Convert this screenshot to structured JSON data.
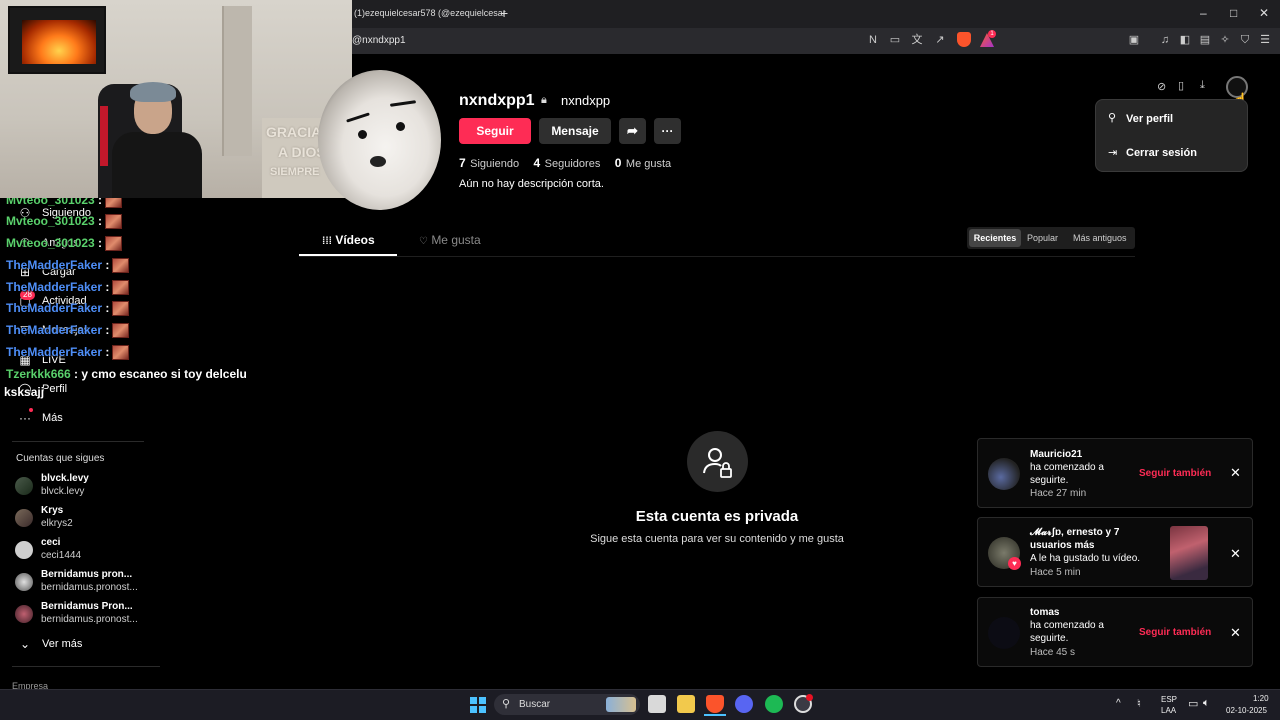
{
  "browser": {
    "tab_title": "(1)ezequielcesar578 (@ezequielcesar",
    "new_tab": "+",
    "url": "@nxndxpp1",
    "window_controls": {
      "minimize": "–",
      "maximize": "□",
      "close": "✕"
    },
    "badge_count": "1"
  },
  "sidebar": {
    "items": [
      {
        "label": "Siguiendo",
        "icon": "following-icon"
      },
      {
        "label": "Amigos",
        "icon": "friends-icon"
      },
      {
        "label": "Cargar",
        "icon": "upload-icon"
      },
      {
        "label": "Actividad",
        "icon": "activity-icon",
        "badge": "28"
      },
      {
        "label": "Mensajes",
        "icon": "messages-icon"
      },
      {
        "label": "LIVE",
        "icon": "live-icon"
      },
      {
        "label": "Perfil",
        "icon": "profile-icon"
      },
      {
        "label": "Más",
        "icon": "more-icon"
      }
    ],
    "following_title": "Cuentas que sigues",
    "accounts": [
      {
        "name": "blvck.levy",
        "handle": "blvck.levy"
      },
      {
        "name": "Krys",
        "handle": "elkrys2"
      },
      {
        "name": "ceci",
        "handle": "ceci1444"
      },
      {
        "name": "Bernidamus pron...",
        "handle": "bernidamus.pronost..."
      },
      {
        "name": "Bernidamus Pron...",
        "handle": "bernidamus.pronost..."
      }
    ],
    "see_more": "Ver más",
    "footer": "Empresa"
  },
  "chat": [
    {
      "user": "Mvteoo_301023",
      "sep": " :"
    },
    {
      "user": "Mvteoo_301023",
      "sep": " :"
    },
    {
      "user": "Mvteoo_301023",
      "sep": " :"
    },
    {
      "user": "TheMadderFaker",
      "sep": " :"
    },
    {
      "user": "TheMadderFaker",
      "sep": " :"
    },
    {
      "user": "TheMadderFaker",
      "sep": " :"
    },
    {
      "user": "TheMadderFaker",
      "sep": " :"
    },
    {
      "user": "TheMadderFaker",
      "sep": " :"
    },
    {
      "user": "Tzerkkk666",
      "sep": " :",
      "message": " y cmo escaneo si toy delcelu",
      "message2": "ksksajj"
    }
  ],
  "webcam": {
    "poster_line1": "GRACIAS",
    "poster_line2": "A DIOS",
    "poster_line3": "SIEMPRE"
  },
  "profile": {
    "username": "nxndxpp1",
    "nickname": "nxndxpp",
    "follow_label": "Seguir",
    "message_label": "Mensaje",
    "share_icon": "share-icon",
    "more_icon": "more-icon",
    "following_count": "7",
    "following_label": "Siguiendo",
    "followers_count": "4",
    "followers_label": "Seguidores",
    "likes_count": "0",
    "likes_label": "Me gusta",
    "bio": "Aún no hay descripción corta."
  },
  "tabs": [
    {
      "label": "Vídeos",
      "active": true
    },
    {
      "label": "Me gusta",
      "active": false
    }
  ],
  "sort_options": [
    "Recientes",
    "Popular",
    "Más antiguos"
  ],
  "private": {
    "title": "Esta cuenta es privada",
    "subtitle": "Sigue esta cuenta para ver su contenido y me gusta"
  },
  "dropdown": {
    "items": [
      {
        "label": "Ver perfil",
        "icon": "user-icon"
      },
      {
        "label": "Cerrar sesión",
        "icon": "logout-icon"
      }
    ]
  },
  "notifications": [
    {
      "title": "Mauricio21",
      "line1": "ha comenzado a",
      "line2": "seguirte.",
      "time": "Hace 27 min",
      "action": "Seguir también"
    },
    {
      "title": "𝓜𝓪𝓻ʃɒ, ernesto y 7",
      "line1": "usuarios más",
      "line2": "A le ha gustado tu vídeo.",
      "time": "Hace 5 min",
      "action": ""
    },
    {
      "title": "tomas",
      "line1": "ha comenzado a",
      "line2": "seguirte.",
      "time": "Hace 45 s",
      "action": "Seguir también"
    }
  ],
  "taskbar": {
    "search_placeholder": "Buscar",
    "lang1": "ESP",
    "lang2": "LAA",
    "time": "1:20",
    "date": "02-10-2025"
  },
  "colors": {
    "accent": "#fe2c55",
    "background": "#000000"
  }
}
